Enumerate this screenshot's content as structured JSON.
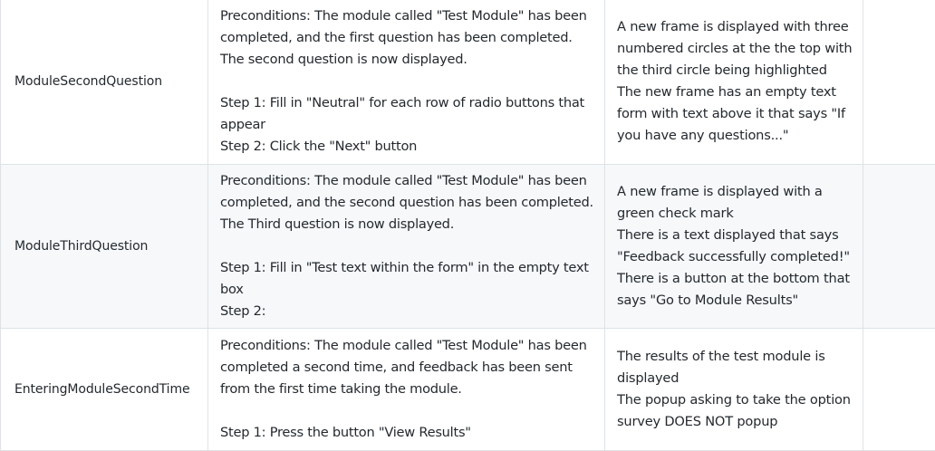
{
  "rows": [
    {
      "name": "ModuleSecondQuestion",
      "steps": [
        "Preconditions: The module called \"Test Module\" has been",
        "completed, and the first question has been completed.",
        "The second question is now displayed.",
        "",
        "Step 1: Fill in \"Neutral\" for each row of radio buttons that",
        "appear",
        "Step 2: Click the \"Next\" button"
      ],
      "result": [
        "A new frame is displayed with three",
        "numbered circles at the the top with",
        "the third circle being highlighted",
        "The new frame has an empty text",
        "form with text above it that says \"If",
        "you have any questions...\""
      ],
      "extra": ""
    },
    {
      "name": "ModuleThirdQuestion",
      "steps": [
        "Preconditions: The module called \"Test Module\" has been",
        "completed, and the second question has been completed.",
        "The Third question is now displayed.",
        "",
        "Step 1: Fill in \"Test text within the form\" in the empty text",
        "box",
        "Step 2:"
      ],
      "result": [
        "A new frame is displayed with a",
        "green check mark",
        "There is a text displayed that says",
        "\"Feedback successfully completed!\"",
        "There is a button at the bottom that",
        "says \"Go to Module Results\""
      ],
      "extra": ""
    },
    {
      "name": "EnteringModuleSecondTime",
      "steps": [
        "Preconditions: The module called \"Test Module\" has been",
        "completed a second time, and feedback has been sent",
        "from the first time taking the module.",
        "",
        "Step 1: Press the button \"View Results\""
      ],
      "result": [
        "The results of the test module is",
        "displayed",
        "The popup asking to take the option",
        "survey DOES NOT popup"
      ],
      "extra": ""
    }
  ]
}
